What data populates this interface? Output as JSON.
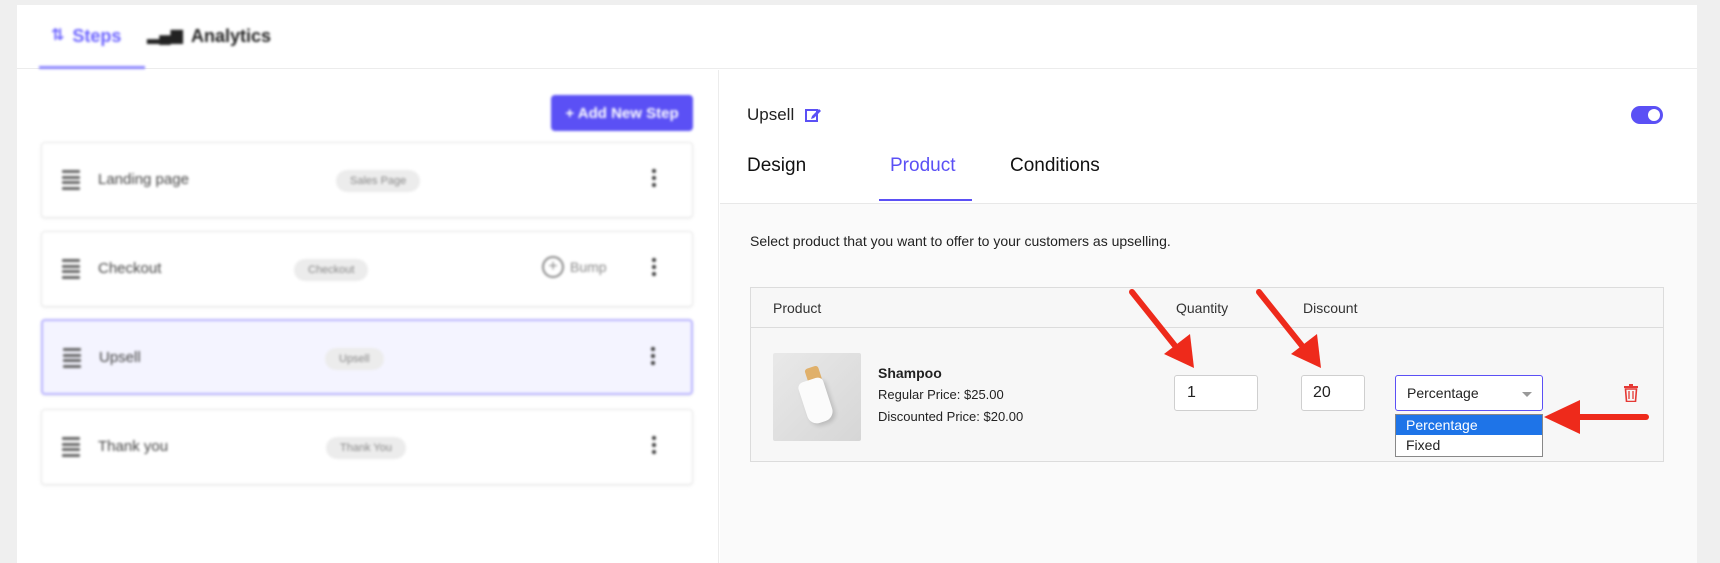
{
  "topbar": {
    "tabs": [
      {
        "label": "Steps",
        "icon": "steps-icon"
      },
      {
        "label": "Analytics",
        "icon": "bar-chart-icon"
      }
    ]
  },
  "left": {
    "add_step_label": "+ Add New Step",
    "steps": [
      {
        "name": "Landing page",
        "badge": "Sales Page"
      },
      {
        "name": "Checkout",
        "badge": "Checkout",
        "extra": "Bump"
      },
      {
        "name": "Upsell",
        "badge": "Upsell"
      },
      {
        "name": "Thank you",
        "badge": "Thank You"
      }
    ]
  },
  "right": {
    "step_title": "Upsell",
    "subtabs": [
      "Design",
      "Product",
      "Conditions"
    ],
    "active_subtab": "Product",
    "description": "Select product that you want to offer to your customers as upselling.",
    "table": {
      "headers": {
        "product": "Product",
        "quantity": "Quantity",
        "discount": "Discount"
      },
      "row": {
        "name": "Shampoo",
        "regular_price": "Regular Price: $25.00",
        "discounted_price": "Discounted Price: $20.00",
        "quantity": "1",
        "discount": "20",
        "discount_type": "Percentage"
      },
      "dropdown_options": [
        "Percentage",
        "Fixed"
      ]
    }
  },
  "colors": {
    "accent": "#5b50f5",
    "annotation_arrow": "#ee2a1b",
    "option_selected": "#1e74e8"
  }
}
